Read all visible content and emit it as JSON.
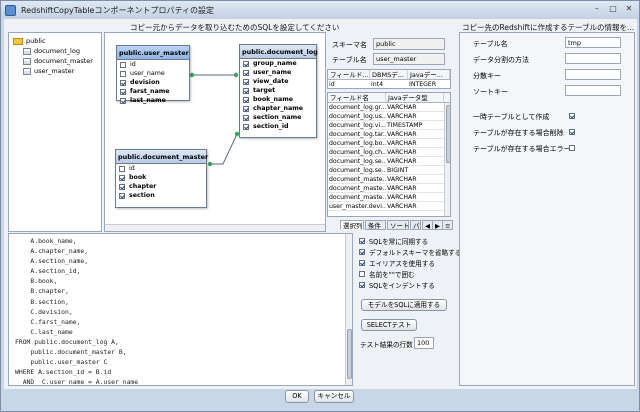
{
  "window": {
    "title": "RedshiftCopyTableコンポーネントプロパティの設定",
    "minimize": "–",
    "maximize": "□",
    "close": "✕"
  },
  "left_header": "コピー元からデータを取り込むためのSQLを設定してください",
  "right_header": "コピー先のRedshiftに作成するテーブルの情報を...",
  "tree": {
    "root": "public",
    "items": [
      "document_log",
      "document_master",
      "user_master"
    ]
  },
  "diagram": {
    "tables": [
      {
        "title": "public.user_master",
        "fields": [
          {
            "name": "id",
            "checked": false
          },
          {
            "name": "user_name",
            "checked": false
          },
          {
            "name": "devision",
            "checked": true
          },
          {
            "name": "farst_name",
            "checked": true
          },
          {
            "name": "last_name",
            "checked": true
          }
        ]
      },
      {
        "title": "public.document_log",
        "fields": [
          {
            "name": "group_name",
            "checked": true
          },
          {
            "name": "user_name",
            "checked": true
          },
          {
            "name": "view_date",
            "checked": true
          },
          {
            "name": "target",
            "checked": true
          },
          {
            "name": "book_name",
            "checked": true
          },
          {
            "name": "chapter_name",
            "checked": true
          },
          {
            "name": "section_name",
            "checked": true
          },
          {
            "name": "section_id",
            "checked": true
          }
        ]
      },
      {
        "title": "public.document_master",
        "fields": [
          {
            "name": "id",
            "checked": false
          },
          {
            "name": "book",
            "checked": true
          },
          {
            "name": "chapter",
            "checked": true
          },
          {
            "name": "section",
            "checked": true
          }
        ]
      }
    ]
  },
  "schema": {
    "schema_label": "スキーマ名",
    "schema_value": "public",
    "table_label": "テーブル名",
    "table_value": "user_master"
  },
  "field_grid_small": {
    "headers": [
      "フィールド...",
      "DBMSデ...",
      "Javaデー..."
    ],
    "row": [
      "id",
      "int4",
      "INTEGER"
    ]
  },
  "field_grid": {
    "headers": [
      "フィールド名",
      "Javaデータ型"
    ],
    "rows": [
      [
        "document_log.gr...",
        "VARCHAR"
      ],
      [
        "document_log.us...",
        "VARCHAR"
      ],
      [
        "document_log.vi...",
        "TIMESTAMP"
      ],
      [
        "document_log.tar...",
        "VARCHAR"
      ],
      [
        "document_log.bo...",
        "VARCHAR"
      ],
      [
        "document_log.ch...",
        "VARCHAR"
      ],
      [
        "document_log.se...",
        "VARCHAR"
      ],
      [
        "document_log.se...",
        "BIGINT"
      ],
      [
        "document_maste...",
        "VARCHAR"
      ],
      [
        "document_maste...",
        "VARCHAR"
      ],
      [
        "document_maste...",
        "VARCHAR"
      ],
      [
        "user_master.devi...",
        "VARCHAR"
      ]
    ]
  },
  "tabs": [
    "選択列",
    "条件",
    "ソート",
    "パ"
  ],
  "sql_lines": [
    "    A.book_name,",
    "    A.chapter_name,",
    "    A.section_name,",
    "    A.section_id,",
    "    B.book,",
    "    B.chapter,",
    "    B.section,",
    "    C.devision,",
    "    C.farst_name,",
    "    C.last_name",
    "FROM public.document_log A,",
    "    public.document_master B,",
    "    public.user_master C",
    "WHERE A.section_id = B.id",
    "  AND  C.user_name = A.user_name"
  ],
  "sql_options": [
    {
      "label": "SQLを常に同期する",
      "checked": true
    },
    {
      "label": "デフォルトスキーマを省略する",
      "checked": true
    },
    {
      "label": "エイリアスを使用する",
      "checked": true
    },
    {
      "label": "名前を\"\"で囲む",
      "checked": false
    },
    {
      "label": "SQLをインデントする",
      "checked": true
    }
  ],
  "apply_model_button": "モデルをSQLに適用する",
  "select_test_button": "SELECTテスト",
  "test_rows_label": "テスト結果の行数",
  "test_rows_value": "100",
  "dest": {
    "table_name_label": "テーブル名",
    "table_name_value": "tmp",
    "split_method_label": "データ分割の方法",
    "split_method_value": "",
    "split_key_label": "分散キー",
    "split_key_value": "",
    "sort_key_label": "ソートキー",
    "sort_key_value": "",
    "temp_table_label": "一時テーブルとして作成",
    "temp_table_checked": true,
    "drop_existing_label": "テーブルが存在する場合削除",
    "drop_existing_checked": true,
    "error_existing_label": "テーブルが存在する場合エラー",
    "error_existing_checked": false
  },
  "ok_button": "OK",
  "cancel_button": "キャンセル"
}
